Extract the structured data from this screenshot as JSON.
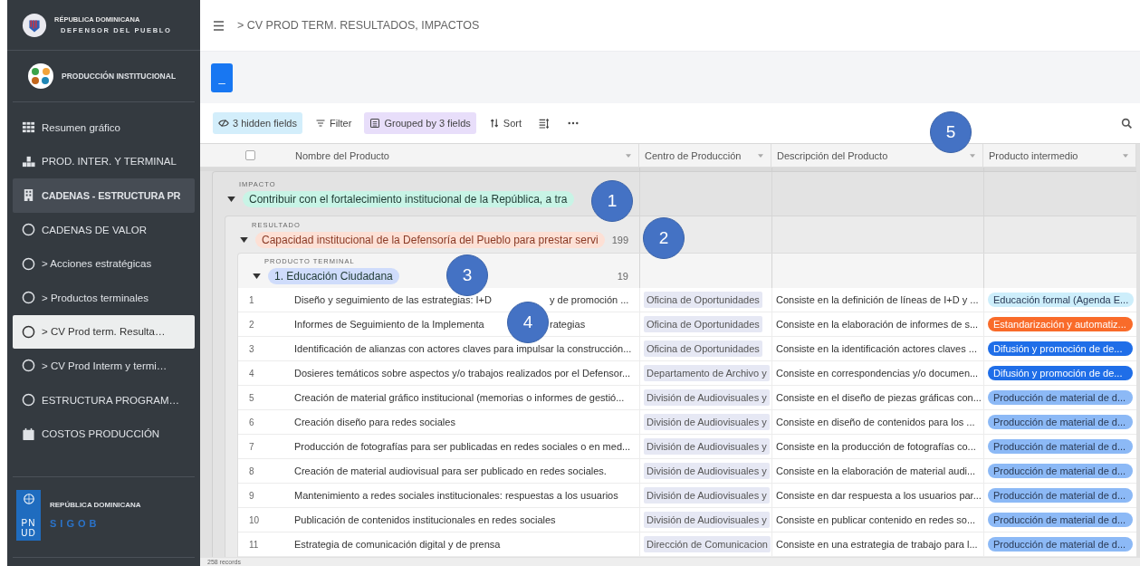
{
  "sidebar": {
    "org_top": "RÉPUBLICA DOMINICANA",
    "org_name": "DEFENSOR DEL PUEBLO",
    "app_name": "PRODUCCIÓN INSTITUCIONAL",
    "items": [
      {
        "label": "Resumen gráfico",
        "kind": "summary",
        "selected": false
      },
      {
        "label": "PROD. INTER. Y TERMINAL",
        "kind": "products",
        "selected": false
      },
      {
        "label": "CADENAS - ESTRUCTURA PR",
        "kind": "section",
        "selected": false
      },
      {
        "label": "CADENAS DE VALOR",
        "kind": "view",
        "selected": false
      },
      {
        "label": "> Acciones estratégicas",
        "kind": "view",
        "selected": false
      },
      {
        "label": "> Productos terminales",
        "kind": "view",
        "selected": false
      },
      {
        "label": "> CV Prod term. Resulta…",
        "kind": "view",
        "selected": true
      },
      {
        "label": "> CV Prod Interm y termi…",
        "kind": "view",
        "selected": false
      },
      {
        "label": "ESTRUCTURA PROGRAM…",
        "kind": "view",
        "selected": false
      },
      {
        "label": "COSTOS PRODUCCIÓN",
        "kind": "costs",
        "selected": false
      }
    ],
    "footer_country": "REPÚBLICA DOMINICANA",
    "footer_brand": "SIGOB",
    "footer_logo": "PNUD"
  },
  "breadcrumb": "> CV PROD TERM. RESULTADOS, IMPACTOS",
  "action_button": "_",
  "toolbar": [
    {
      "label": "3 hidden fields",
      "kind": "hidden"
    },
    {
      "label": "Filter",
      "kind": "filter"
    },
    {
      "label": "Grouped by 3 fields",
      "kind": "grouped"
    },
    {
      "label": "Sort",
      "kind": "sort"
    }
  ],
  "table": {
    "select_all_checked": false,
    "columns": [
      "Nombre del Producto",
      "Centro de Producción",
      "Descripción del Producto",
      "Producto intermedio"
    ],
    "groups": [
      {
        "level_label": "IMPACTO",
        "value": "Contribuir con el fortalecimiento institucional de la República, a tra",
        "color": "#c8f4e6"
      },
      {
        "level_label": "RESULTADO",
        "value": "Capacidad institucional de la Defensoría del Pueblo para prestar servi",
        "count": "199",
        "color": "#fde0d5"
      },
      {
        "level_label": "PRODUCTO TERMINAL",
        "value": "1. Educación Ciudadana",
        "count": "19",
        "color": "#cfdcfb"
      }
    ],
    "rows": [
      {
        "num": "1",
        "name": "Diseño y seguimiento de las estrategias: I+D",
        "name_rest": "y de promoción ...",
        "centro": "Oficina de Oportunidades",
        "desc": "Consiste en la definición de líneas de I+D y ...",
        "intermedio": "Educación formal (Agenda E...",
        "color": "#cdeefb"
      },
      {
        "num": "2",
        "name": "Informes de Seguimiento de la Implementa",
        "name_rest": "rategias",
        "centro": "Oficina de Oportunidades",
        "desc": "Consiste en la elaboración de informes de s...",
        "intermedio": "Estandarización y automatiz...",
        "color": "#f96b2a"
      },
      {
        "num": "3",
        "name": "Identificación de alianzas con actores claves para impulsar la construcción...",
        "centro": "Oficina de Oportunidades",
        "desc": "Consiste en la identificación actores claves ...",
        "intermedio": "Difusión y promoción de de...",
        "color": "#1f6ee8"
      },
      {
        "num": "4",
        "name": "Dosieres temáticos sobre aspectos y/o trabajos realizados por el Defensor...",
        "centro": "Departamento de Archivo y",
        "desc": "Consiste en correspondencias y/o documen...",
        "intermedio": "Difusión y promoción de de...",
        "color": "#1f6ee8"
      },
      {
        "num": "5",
        "name": "Creación de material gráfico institucional (memorias o informes de gestió...",
        "centro": "División de Audiovisuales y",
        "desc": "Consiste en el diseño de piezas gráficas con...",
        "intermedio": "Producción de material de d...",
        "color": "#8cb9f6"
      },
      {
        "num": "6",
        "name": "Creación diseño para redes sociales",
        "centro": "División de Audiovisuales y",
        "desc": "Consiste en diseño de contenidos para los ...",
        "intermedio": "Producción de material de d...",
        "color": "#8cb9f6"
      },
      {
        "num": "7",
        "name": "Producción de fotografías para ser publicadas en redes sociales o en med...",
        "centro": "División de Audiovisuales y",
        "desc": "Consiste en la producción de fotografías co...",
        "intermedio": "Producción de material de d...",
        "color": "#8cb9f6"
      },
      {
        "num": "8",
        "name": "Creación de material audiovisual para ser publicado en redes sociales.",
        "centro": "División de Audiovisuales y",
        "desc": "Consiste en la elaboración de material audi...",
        "intermedio": "Producción de material de d...",
        "color": "#8cb9f6"
      },
      {
        "num": "9",
        "name": "Mantenimiento a redes sociales institucionales: respuestas a los usuarios",
        "centro": "División de Audiovisuales y",
        "desc": "Consiste en dar respuesta a los usuarios par...",
        "intermedio": "Producción de material de d...",
        "color": "#8cb9f6"
      },
      {
        "num": "10",
        "name": "Publicación de contenidos institucionales en redes sociales",
        "centro": "División de Audiovisuales y",
        "desc": "Consiste en publicar contenido en redes so...",
        "intermedio": "Producción de material de d...",
        "color": "#8cb9f6"
      },
      {
        "num": "11",
        "name": "Estrategia de comunicación digital y de prensa",
        "centro": "Dirección de Comunicacion",
        "desc": "Consiste en una estrategia de trabajo para l...",
        "intermedio": "Producción de material de d...",
        "color": "#8cb9f6"
      }
    ],
    "footer": "258 records"
  },
  "callouts": [
    "1",
    "2",
    "3",
    "4",
    "5"
  ]
}
